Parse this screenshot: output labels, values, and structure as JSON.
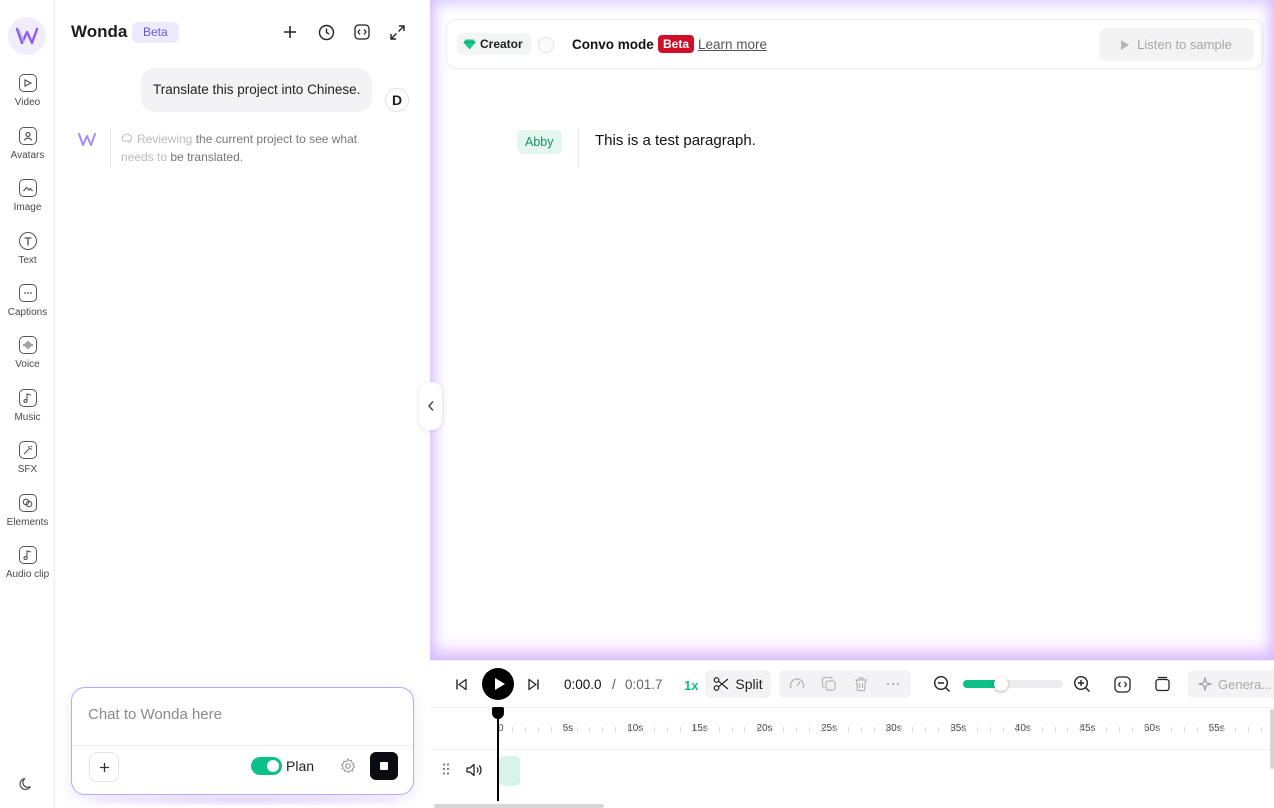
{
  "rail": {
    "items": [
      {
        "label": "Video",
        "icon": "video-icon"
      },
      {
        "label": "Avatars",
        "icon": "avatar-icon"
      },
      {
        "label": "Image",
        "icon": "image-icon"
      },
      {
        "label": "Text",
        "icon": "text-icon"
      },
      {
        "label": "Captions",
        "icon": "captions-icon"
      },
      {
        "label": "Voice",
        "icon": "voice-icon"
      },
      {
        "label": "Music",
        "icon": "music-icon"
      },
      {
        "label": "SFX",
        "icon": "sfx-icon"
      },
      {
        "label": "Elements",
        "icon": "elements-icon"
      },
      {
        "label": "Audio clip",
        "icon": "audio-clip-icon"
      }
    ]
  },
  "chat": {
    "title": "Wonda",
    "badge": "Beta",
    "user_message": "Translate this project into Chinese.",
    "user_initial": "D",
    "thinking_faded": "Reviewing",
    "thinking_text": " the current project to see what ",
    "thinking_faded2": "needs to",
    "thinking_text2": " be translated.",
    "composer_placeholder": "Chat to Wonda here",
    "plan_label": "Plan"
  },
  "editor": {
    "creator_label": "Creator",
    "convo_label": "Convo mode",
    "convo_badge": "Beta",
    "learn_more": "Learn more",
    "listen_label": "Listen to sample",
    "speaker": "Abby",
    "paragraph": "This is a test paragraph."
  },
  "timeline": {
    "time_current": "0:00.0",
    "time_sep": "/",
    "time_total": "0:01.7",
    "speed": "1x",
    "split_label": "Split",
    "generate_label": "Genera...",
    "zoom_fraction": 0.38,
    "ruler_labels": [
      "0",
      "5s",
      "10s",
      "15s",
      "20s",
      "25s",
      "30s",
      "35s",
      "40s",
      "45s",
      "50s",
      "55s",
      "0"
    ]
  },
  "colors": {
    "accent": "#0dbf88",
    "brand": "#6a5acd",
    "beta_red": "#d0102b"
  }
}
